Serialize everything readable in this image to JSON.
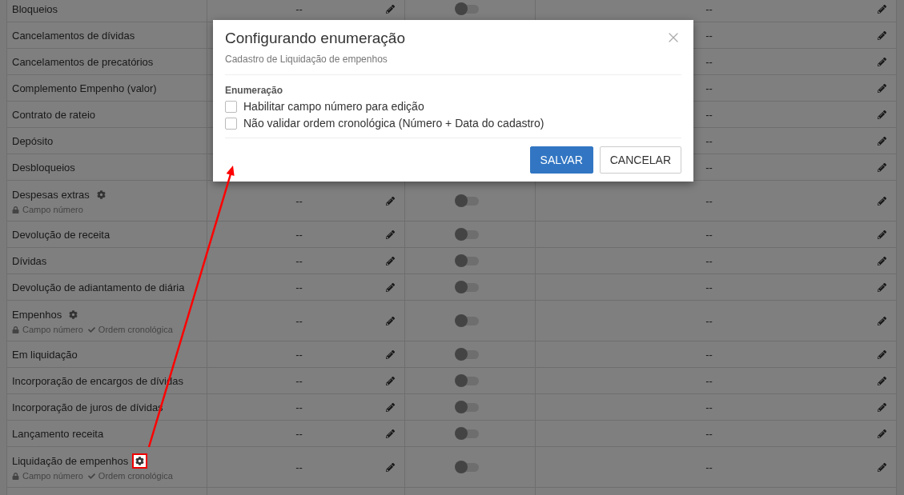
{
  "rows": [
    {
      "name": "Bloqueios",
      "gear": false,
      "value_1": "--",
      "on": false,
      "value_2": "--"
    },
    {
      "name": "Cancelamentos de dívidas",
      "gear": false,
      "value_2": "--"
    },
    {
      "name": "Cancelamentos de precatórios",
      "gear": false,
      "value_2": "--"
    },
    {
      "name": "Complemento Empenho (valor)",
      "gear": false,
      "value_2": "--"
    },
    {
      "name": "Contrato de rateio",
      "gear": false,
      "value_2": "--"
    },
    {
      "name": "Depósito",
      "gear": false,
      "value_2": "--"
    },
    {
      "name": "Desbloqueios",
      "gear": false,
      "value_2": "--"
    },
    {
      "name": "Despesas extras",
      "gear": true,
      "tags": [
        {
          "kind": "lock",
          "text": "Campo número"
        }
      ],
      "value_1": "--",
      "on": false,
      "value_2": "--"
    },
    {
      "name": "Devolução de receita",
      "gear": false,
      "value_1": "--",
      "on": false,
      "value_2": "--"
    },
    {
      "name": "Dívidas",
      "gear": false,
      "value_1": "--",
      "on": false,
      "value_2": "--"
    },
    {
      "name": "Devolução de adiantamento de diária",
      "gear": false,
      "value_1": "--",
      "on": false,
      "value_2": "--"
    },
    {
      "name": "Empenhos",
      "gear": true,
      "tags": [
        {
          "kind": "lock",
          "text": "Campo número"
        },
        {
          "kind": "check",
          "text": "Ordem cronológica"
        }
      ],
      "value_1": "--",
      "on": false,
      "value_2": "--"
    },
    {
      "name": "Em liquidação",
      "gear": false,
      "value_1": "--",
      "on": false,
      "value_2": "--"
    },
    {
      "name": "Incorporação de encargos de dívidas",
      "gear": false,
      "value_1": "--",
      "on": false,
      "value_2": "--"
    },
    {
      "name": "Incorporação de juros de dívidas",
      "gear": false,
      "value_1": "--",
      "on": false,
      "value_2": "--"
    },
    {
      "name": "Lançamento receita",
      "gear": false,
      "value_1": "--",
      "on": false,
      "value_2": "--"
    },
    {
      "name": "Liquidação de empenhos",
      "gear": true,
      "highlighted": true,
      "tags": [
        {
          "kind": "lock",
          "text": "Campo número"
        },
        {
          "kind": "check",
          "text": "Ordem cronológica"
        }
      ],
      "value_1": "--",
      "on": false,
      "value_2": "--"
    }
  ],
  "dialog": {
    "title": "Configurando enumeração",
    "subtitle": "Cadastro de Liquidação de empenhos",
    "section": "Enumeração",
    "options": [
      {
        "label": "Habilitar campo número para edição",
        "checked": false
      },
      {
        "label": "Não validar ordem cronológica (Número + Data do cadastro)",
        "checked": false
      }
    ],
    "buttons": [
      {
        "label": "SALVAR",
        "kind": "primary"
      },
      {
        "label": "CANCELAR",
        "kind": "secondary"
      }
    ]
  }
}
